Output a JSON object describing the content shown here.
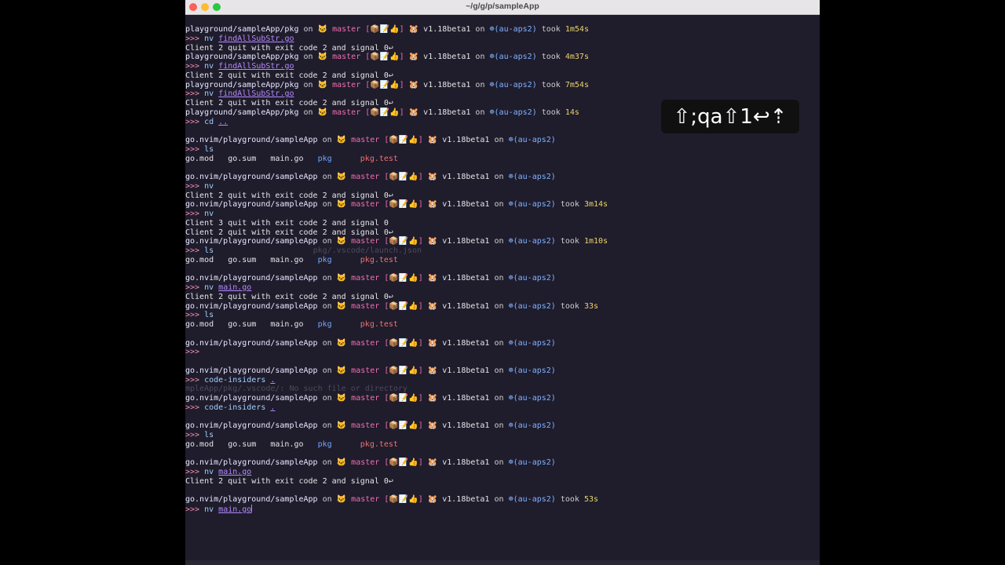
{
  "window": {
    "title": "~/g/g/p/sampleApp"
  },
  "overlay": {
    "keys": "⇧;qa⇧1↩⇡"
  },
  "terminal": {
    "lines": [
      {
        "type": "prompt",
        "path": "playground/sampleApp/pkg",
        "on": "on",
        "cat": "🐱",
        "branch": "master",
        "status": "[📦📝👍]",
        "go": "🐹",
        "version": "v1.18beta1",
        "on2": "on",
        "k8s": "☸",
        "ctx": "(au-aps2)",
        "took": "took",
        "duration": "1m54s"
      },
      {
        "type": "cmd",
        "arrows": ">>>",
        "cmd": "nv",
        "arg": "findAllSubStr.go",
        "ghost": ""
      },
      {
        "type": "out",
        "text": "Client 2 quit with exit code 2 and signal 0↩"
      },
      {
        "type": "prompt",
        "path": "playground/sampleApp/pkg",
        "on": "on",
        "cat": "🐱",
        "branch": "master",
        "status": "[📦📝👍]",
        "go": "🐹",
        "version": "v1.18beta1",
        "on2": "on",
        "k8s": "☸",
        "ctx": "(au-aps2)",
        "took": "took",
        "duration": "4m37s"
      },
      {
        "type": "cmd",
        "arrows": ">>>",
        "cmd": "nv",
        "arg": "findAllSubStr.go",
        "ghost": ""
      },
      {
        "type": "out",
        "text": "Client 2 quit with exit code 2 and signal 0↩"
      },
      {
        "type": "prompt",
        "path": "playground/sampleApp/pkg",
        "on": "on",
        "cat": "🐱",
        "branch": "master",
        "status": "[📦📝👍]",
        "go": "🐹",
        "version": "v1.18beta1",
        "on2": "on",
        "k8s": "☸",
        "ctx": "(au-aps2)",
        "took": "took",
        "duration": "7m54s"
      },
      {
        "type": "cmd",
        "arrows": ">>>",
        "cmd": "nv",
        "arg": "findAllSubStr.go",
        "ghost": ""
      },
      {
        "type": "out",
        "text": "Client 2 quit with exit code 2 and signal 0↩"
      },
      {
        "type": "prompt",
        "path": "playground/sampleApp/pkg",
        "on": "on",
        "cat": "🐱",
        "branch": "master",
        "status": "[📦📝👍]",
        "go": "🐹",
        "version": "v1.18beta1",
        "on2": "on",
        "k8s": "☸",
        "ctx": "(au-aps2)",
        "took": "took",
        "duration": "14s"
      },
      {
        "type": "cmd",
        "arrows": ">>>",
        "cmd": "cd",
        "arg": "..",
        "ghost": ""
      },
      {
        "type": "blank"
      },
      {
        "type": "prompt",
        "path": "go.nvim/playground/sampleApp",
        "on": "on",
        "cat": "🐱",
        "branch": "master",
        "status": "[📦📝👍]",
        "go": "🐹",
        "version": "v1.18beta1",
        "on2": "on",
        "k8s": "☸",
        "ctx": "(au-aps2)",
        "took": "",
        "duration": ""
      },
      {
        "type": "cmd",
        "arrows": ">>>",
        "cmd": "ls",
        "arg": "",
        "ghost": ""
      },
      {
        "type": "ls",
        "f1": "go.mod",
        "f2": "go.sum",
        "f3": "main.go",
        "f4": "pkg",
        "f5": "pkg.test"
      },
      {
        "type": "blank"
      },
      {
        "type": "prompt",
        "path": "go.nvim/playground/sampleApp",
        "on": "on",
        "cat": "🐱",
        "branch": "master",
        "status": "[📦📝👍]",
        "go": "🐹",
        "version": "v1.18beta1",
        "on2": "on",
        "k8s": "☸",
        "ctx": "(au-aps2)",
        "took": "",
        "duration": ""
      },
      {
        "type": "cmd",
        "arrows": ">>>",
        "cmd": "nv",
        "arg": "",
        "ghost": ""
      },
      {
        "type": "out",
        "text": "Client 2 quit with exit code 2 and signal 0↩"
      },
      {
        "type": "prompt",
        "path": "go.nvim/playground/sampleApp",
        "on": "on",
        "cat": "🐱",
        "branch": "master",
        "status": "[📦📝👍]",
        "go": "🐹",
        "version": "v1.18beta1",
        "on2": "on",
        "k8s": "☸",
        "ctx": "(au-aps2)",
        "took": "took",
        "duration": "3m14s"
      },
      {
        "type": "cmd",
        "arrows": ">>>",
        "cmd": "nv",
        "arg": "",
        "ghost": ""
      },
      {
        "type": "out",
        "text": "Client 3 quit with exit code 2 and signal 0"
      },
      {
        "type": "out",
        "text": "Client 2 quit with exit code 2 and signal 0↩"
      },
      {
        "type": "prompt",
        "path": "go.nvim/playground/sampleApp",
        "on": "on",
        "cat": "🐱",
        "branch": "master",
        "status": "[📦📝👍]",
        "go": "🐹",
        "version": "v1.18beta1",
        "on2": "on",
        "k8s": "☸",
        "ctx": "(au-aps2)",
        "took": "took",
        "duration": "1m10s"
      },
      {
        "type": "cmd",
        "arrows": ">>>",
        "cmd": "ls",
        "arg": "",
        "ghost": "                     pkg/.vscode/launch.json"
      },
      {
        "type": "ls",
        "f1": "go.mod",
        "f2": "go.sum",
        "f3": "main.go",
        "f4": "pkg",
        "f5": "pkg.test"
      },
      {
        "type": "blank"
      },
      {
        "type": "prompt",
        "path": "go.nvim/playground/sampleApp",
        "on": "on",
        "cat": "🐱",
        "branch": "master",
        "status": "[📦📝👍]",
        "go": "🐹",
        "version": "v1.18beta1",
        "on2": "on",
        "k8s": "☸",
        "ctx": "(au-aps2)",
        "took": "",
        "duration": ""
      },
      {
        "type": "cmd",
        "arrows": ">>>",
        "cmd": "nv",
        "arg": "main.go",
        "ghost": ""
      },
      {
        "type": "out",
        "text": "Client 2 quit with exit code 2 and signal 0↩"
      },
      {
        "type": "prompt",
        "path": "go.nvim/playground/sampleApp",
        "on": "on",
        "cat": "🐱",
        "branch": "master",
        "status": "[📦📝👍]",
        "go": "🐹",
        "version": "v1.18beta1",
        "on2": "on",
        "k8s": "☸",
        "ctx": "(au-aps2)",
        "took": "took",
        "duration": "33s"
      },
      {
        "type": "cmd",
        "arrows": ">>>",
        "cmd": "ls",
        "arg": "",
        "ghost": ""
      },
      {
        "type": "ls",
        "f1": "go.mod",
        "f2": "go.sum",
        "f3": "main.go",
        "f4": "pkg",
        "f5": "pkg.test"
      },
      {
        "type": "blank"
      },
      {
        "type": "prompt",
        "path": "go.nvim/playground/sampleApp",
        "on": "on",
        "cat": "🐱",
        "branch": "master",
        "status": "[📦📝👍]",
        "go": "🐹",
        "version": "v1.18beta1",
        "on2": "on",
        "k8s": "☸",
        "ctx": "(au-aps2)",
        "took": "",
        "duration": ""
      },
      {
        "type": "cmd",
        "arrows": ">>>",
        "cmd": "",
        "arg": "",
        "ghost": ""
      },
      {
        "type": "blank"
      },
      {
        "type": "prompt",
        "path": "go.nvim/playground/sampleApp",
        "on": "on",
        "cat": "🐱",
        "branch": "master",
        "status": "[📦📝👍]",
        "go": "🐹",
        "version": "v1.18beta1",
        "on2": "on",
        "k8s": "☸",
        "ctx": "(au-aps2)",
        "took": "",
        "duration": ""
      },
      {
        "type": "cmd",
        "arrows": ">>>",
        "cmd": "code-insiders",
        "arg": ".",
        "ghost": ""
      },
      {
        "type": "ghostline",
        "text": "mpleApp/pkg/.vscode/: No such file or directory"
      },
      {
        "type": "prompt",
        "path": "go.nvim/playground/sampleApp",
        "on": "on",
        "cat": "🐱",
        "branch": "master",
        "status": "[📦📝👍]",
        "go": "🐹",
        "version": "v1.18beta1",
        "on2": "on",
        "k8s": "☸",
        "ctx": "(au-aps2)",
        "took": "",
        "duration": ""
      },
      {
        "type": "cmd",
        "arrows": ">>>",
        "cmd": "code-insiders",
        "arg": ".",
        "ghost": ""
      },
      {
        "type": "blank"
      },
      {
        "type": "prompt",
        "path": "go.nvim/playground/sampleApp",
        "on": "on",
        "cat": "🐱",
        "branch": "master",
        "status": "[📦📝👍]",
        "go": "🐹",
        "version": "v1.18beta1",
        "on2": "on",
        "k8s": "☸",
        "ctx": "(au-aps2)",
        "took": "",
        "duration": ""
      },
      {
        "type": "cmd",
        "arrows": ">>>",
        "cmd": "ls",
        "arg": "",
        "ghost": ""
      },
      {
        "type": "ls",
        "f1": "go.mod",
        "f2": "go.sum",
        "f3": "main.go",
        "f4": "pkg",
        "f5": "pkg.test"
      },
      {
        "type": "blank"
      },
      {
        "type": "prompt",
        "path": "go.nvim/playground/sampleApp",
        "on": "on",
        "cat": "🐱",
        "branch": "master",
        "status": "[📦📝👍]",
        "go": "🐹",
        "version": "v1.18beta1",
        "on2": "on",
        "k8s": "☸",
        "ctx": "(au-aps2)",
        "took": "",
        "duration": ""
      },
      {
        "type": "cmd",
        "arrows": ">>>",
        "cmd": "nv",
        "arg": "main.go",
        "ghost": ""
      },
      {
        "type": "out",
        "text": "Client 2 quit with exit code 2 and signal 0↩"
      },
      {
        "type": "blank"
      },
      {
        "type": "prompt",
        "path": "go.nvim/playground/sampleApp",
        "on": "on",
        "cat": "🐱",
        "branch": "master",
        "status": "[📦📝👍]",
        "go": "🐹",
        "version": "v1.18beta1",
        "on2": "on",
        "k8s": "☸",
        "ctx": "(au-aps2)",
        "took": "took",
        "duration": "53s"
      },
      {
        "type": "cmd",
        "arrows": ">>>",
        "cmd": "nv",
        "arg": "main.go",
        "ghost": "",
        "cursor": true
      }
    ]
  },
  "colors": {
    "terminal_bg": "#1f1c2c",
    "branch": "#f06fb0",
    "k8s": "#7fb3ff",
    "duration": "#e9d56a",
    "arg": "#b58bff",
    "pkg_dir": "#6ea8ff",
    "pkg_test": "#f07070"
  }
}
